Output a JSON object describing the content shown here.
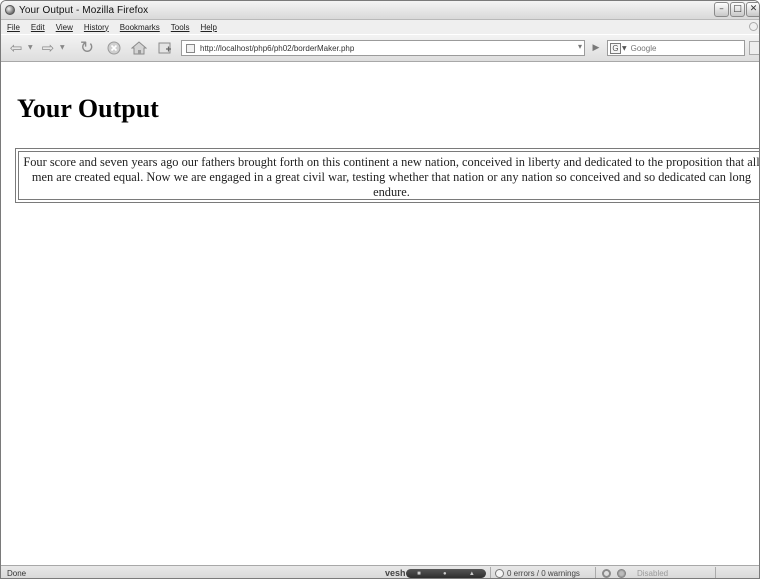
{
  "window": {
    "title": "Your Output - Mozilla Firefox"
  },
  "menu": {
    "items": [
      "File",
      "Edit",
      "View",
      "History",
      "Bookmarks",
      "Tools",
      "Help"
    ]
  },
  "nav": {
    "url": "http://localhost/php6/ph02/borderMaker.php",
    "search_placeholder": "Google",
    "search_engine_glyph": "G",
    "icons": [
      "back-arrow-icon",
      "forward-arrow-icon",
      "reload-icon",
      "stop-icon",
      "home-icon",
      "bookmark-page-icon"
    ]
  },
  "page": {
    "heading": "Your Output",
    "paragraph": "Four score and seven years ago our fathers brought forth on this continent a new nation, conceived in liberty and dedicated to the proposition that all men are created equal. Now we are engaged in a great civil war, testing whether that nation or any nation so conceived and so dedicated can long endure.",
    "border_style": "double",
    "border_color": "#7a7a7a"
  },
  "status": {
    "text": "Done",
    "validator": "0 errors / 0 warnings",
    "extension_state": "Disabled",
    "vesh_label": "vesh"
  }
}
